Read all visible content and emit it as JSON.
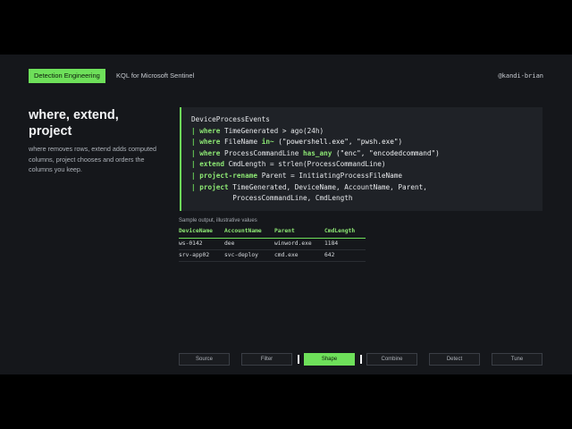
{
  "header": {
    "tag": "Detection Engineering",
    "subtitle": "KQL for Microsoft Sentinel",
    "handle": "@kandi-brian"
  },
  "left": {
    "heading": "where, extend, project",
    "description": "where removes rows, extend adds computed columns, project chooses and orders the columns you keep."
  },
  "code": {
    "table": "DeviceProcessEvents",
    "lines": [
      {
        "kw": "where",
        "rest_a": " TimeGenerated > ago(24h)"
      },
      {
        "kw": "where",
        "rest_a": " FileName ",
        "kw2": "in~",
        "rest_b": " (\"powershell.exe\", \"pwsh.exe\")"
      },
      {
        "kw": "where",
        "rest_a": " ProcessCommandLine ",
        "kw2": "has_any",
        "rest_b": " (\"enc\", \"encodedcommand\")"
      },
      {
        "kw": "extend",
        "rest_a": " CmdLength = strlen(ProcessCommandLine)"
      },
      {
        "kw": "project-rename",
        "rest_a": " Parent = InitiatingProcessFileName"
      },
      {
        "kw": "project",
        "rest_a": " TimeGenerated, DeviceName, AccountName, Parent,"
      }
    ],
    "continuation": "          ProcessCommandLine, CmdLength"
  },
  "output": {
    "label": "Sample output, illustrative values",
    "columns": [
      "DeviceName",
      "AccountName",
      "Parent",
      "CmdLength"
    ],
    "rows": [
      [
        "ws-0142",
        "dee",
        "winword.exe",
        "1184"
      ],
      [
        "srv-app02",
        "svc-deploy",
        "cmd.exe",
        "642"
      ]
    ]
  },
  "nav": {
    "stages": [
      "Source",
      "Filter",
      "Shape",
      "Combine",
      "Detect",
      "Tune"
    ],
    "active": "Shape"
  },
  "colors": {
    "accent": "#6ee05a",
    "background": "#15171b",
    "code_background": "#1f2227"
  }
}
